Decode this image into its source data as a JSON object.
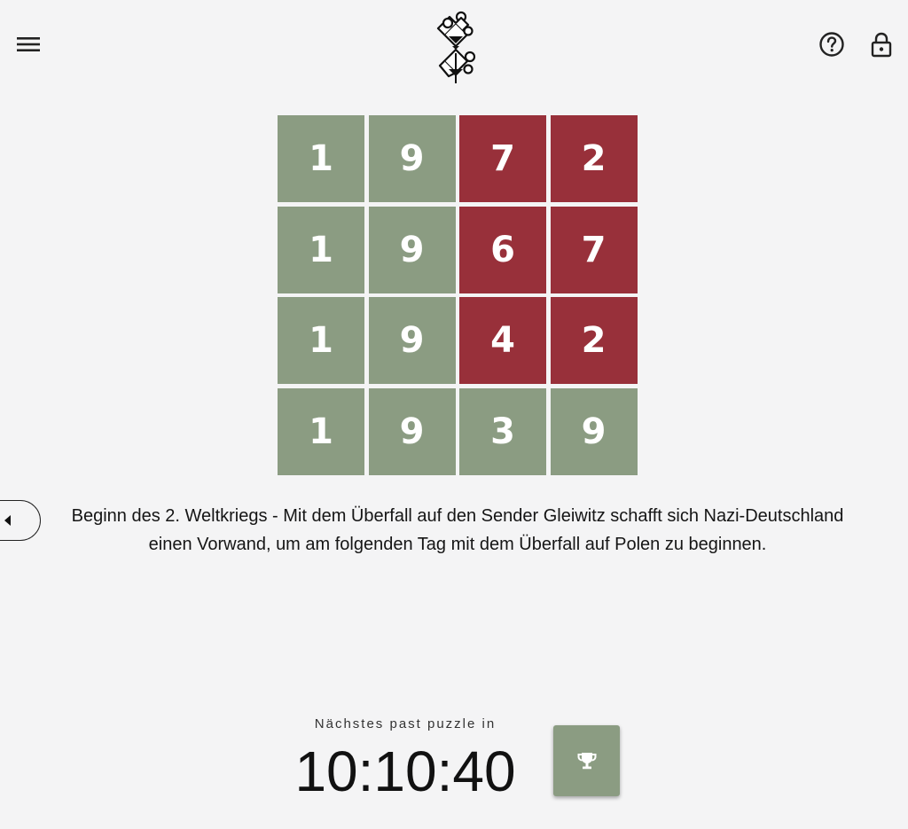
{
  "header": {
    "menu_icon": "menu-icon",
    "logo_icon": "puzzle-hourglass-logo",
    "help_icon": "help-circle-icon",
    "lock_icon": "lock-icon"
  },
  "colors": {
    "correct": "#8b9c82",
    "wrong": "#98303a",
    "background": "#f4f4f5"
  },
  "grid": {
    "rows": [
      {
        "cells": [
          {
            "digit": "1",
            "status": "correct"
          },
          {
            "digit": "9",
            "status": "correct"
          },
          {
            "digit": "7",
            "status": "wrong"
          },
          {
            "digit": "2",
            "status": "wrong"
          }
        ]
      },
      {
        "cells": [
          {
            "digit": "1",
            "status": "correct"
          },
          {
            "digit": "9",
            "status": "correct"
          },
          {
            "digit": "6",
            "status": "wrong"
          },
          {
            "digit": "7",
            "status": "wrong"
          }
        ]
      },
      {
        "cells": [
          {
            "digit": "1",
            "status": "correct"
          },
          {
            "digit": "9",
            "status": "correct"
          },
          {
            "digit": "4",
            "status": "wrong"
          },
          {
            "digit": "2",
            "status": "wrong"
          }
        ]
      },
      {
        "cells": [
          {
            "digit": "1",
            "status": "correct"
          },
          {
            "digit": "9",
            "status": "correct"
          },
          {
            "digit": "3",
            "status": "correct"
          },
          {
            "digit": "9",
            "status": "correct"
          }
        ]
      }
    ]
  },
  "description": "Beginn des 2. Weltkriegs - Mit dem Überfall auf den Sender Gleiwitz schafft sich Nazi-Deutschland einen Vorwand, um am folgenden Tag mit dem Überfall auf Polen zu beginnen.",
  "footer": {
    "next_label": "Nächstes past puzzle in",
    "countdown": "10:10:40",
    "trophy_icon": "trophy-icon"
  }
}
